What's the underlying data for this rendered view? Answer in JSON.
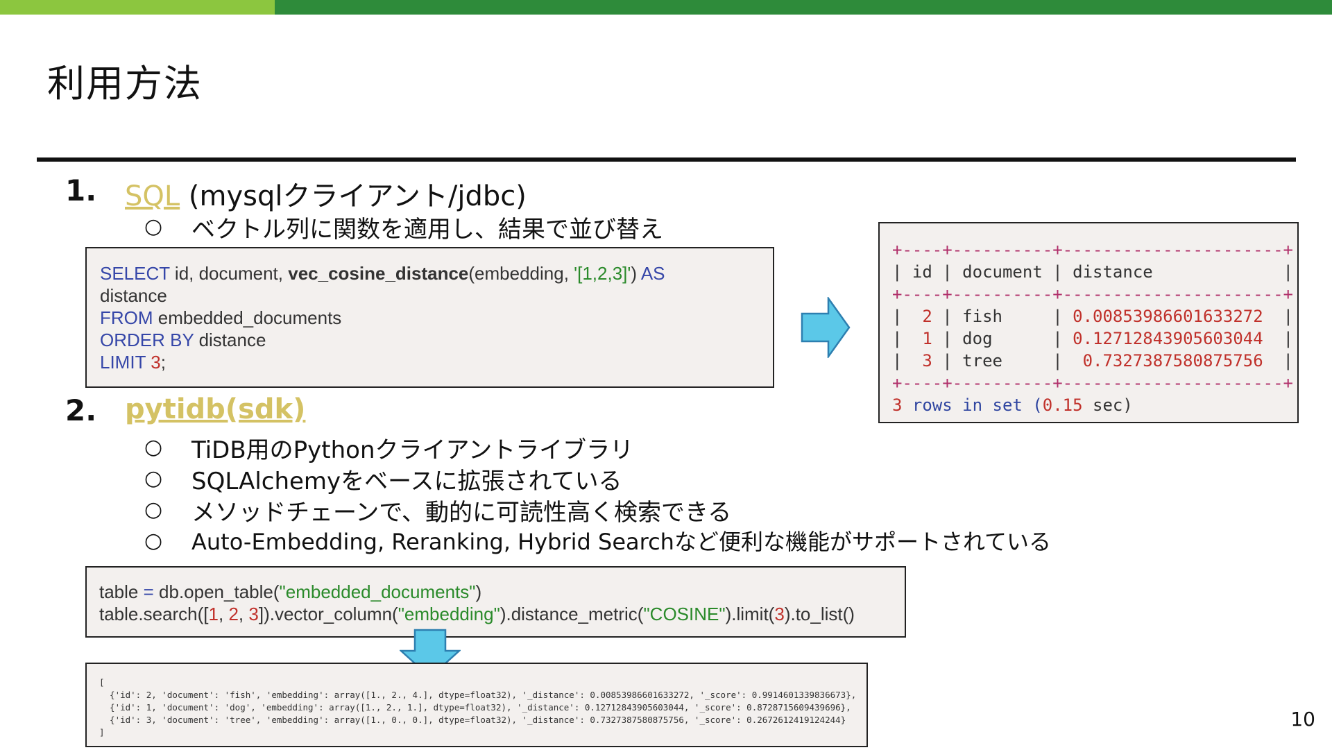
{
  "slide": {
    "title": "利用方法",
    "page_number": "10"
  },
  "section1": {
    "number": "1.",
    "link_text": "SQL",
    "heading_rest": " (mysqlクライアント/jdbc)",
    "bullet_mark": "○",
    "bullet": "ベクトル列に関数を適用し、結果で並び替え"
  },
  "sql_code": {
    "l1_select": "SELECT",
    "l1_cols": " id, document, ",
    "l1_fn": "vec_cosine_distance",
    "l1_open": "(embedding, ",
    "l1_str": "'[1,2,3]'",
    "l1_close": ") ",
    "l1_as": "AS",
    "l2": "distance",
    "l3_from": "FROM",
    "l3_rest": " embedded_documents",
    "l4_order": "ORDER BY",
    "l4_rest": " distance",
    "l5_limit": "LIMIT",
    "l5_num": "3",
    "l5_end": ";"
  },
  "result_table": {
    "border_line": "+----+----------+----------------------+",
    "header_pipe_open": "| ",
    "col_id": "id",
    "col_document": "document",
    "col_distance": "distance",
    "rows": [
      {
        "id": "2",
        "document": "fish",
        "distance": "0.00853986601633272"
      },
      {
        "id": "1",
        "document": "dog",
        "distance": "0.12712843905603044"
      },
      {
        "id": "3",
        "document": "tree",
        "distance": "0.7327387580875756"
      }
    ],
    "footer_count": "3",
    "footer_mid": " rows in set (",
    "footer_time": "0.15",
    "footer_end": " sec)"
  },
  "section2": {
    "number": "2.",
    "link_text": "pytidb(sdk)",
    "bullet_mark": "○",
    "bullets": [
      "TiDB用のPythonクライアントライブラリ",
      "SQLAlchemyをベースに拡張されている",
      "メソッドチェーンで、動的に可読性高く検索できる",
      "Auto-Embedding, Reranking, Hybrid Searchなど便利な機能がサポートされている"
    ]
  },
  "py_code": {
    "l1_a": "table ",
    "l1_eq": "=",
    "l1_b": " db.open_table(",
    "l1_str": "\"embedded_documents\"",
    "l1_c": ")",
    "l2_a": "table.search([",
    "l2_n1": "1",
    "l2_c1": ", ",
    "l2_n2": "2",
    "l2_c2": ", ",
    "l2_n3": "3",
    "l2_b": "]).vector_column(",
    "l2_s1": "\"embedding\"",
    "l2_c": ").distance_metric(",
    "l2_s2": "\"COSINE\"",
    "l2_d": ").limit(",
    "l2_n4": "3",
    "l2_e": ").to_list()"
  },
  "py_output": {
    "open": "[",
    "lines": [
      "  {'id': 2, 'document': 'fish', 'embedding': array([1., 2., 4.], dtype=float32), '_distance': 0.00853986601633272, '_score': 0.9914601339836673},",
      "  {'id': 1, 'document': 'dog', 'embedding': array([1., 2., 1.], dtype=float32), '_distance': 0.12712843905603044, '_score': 0.8728715609439696},",
      "  {'id': 3, 'document': 'tree', 'embedding': array([1., 0., 0.], dtype=float32), '_distance': 0.7327387580875756, '_score': 0.2672612419124244}"
    ],
    "close": "]"
  },
  "colors": {
    "top_bar_light": "#8cc63f",
    "top_bar_dark": "#2e8b3a",
    "link": "#d4c264",
    "arrow_fill": "#5bc8e8",
    "keyword": "#3546a8",
    "string": "#2a8a2a",
    "number": "#c0302a"
  }
}
